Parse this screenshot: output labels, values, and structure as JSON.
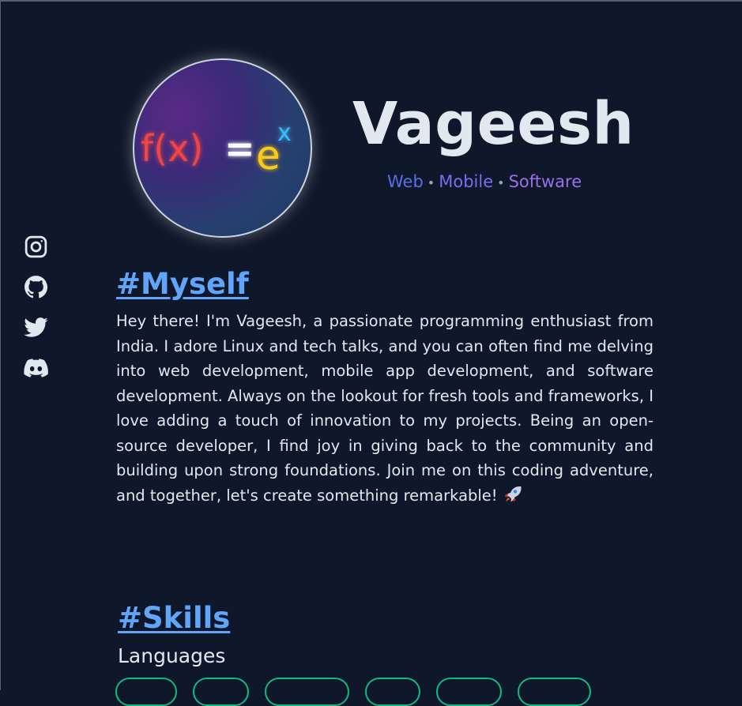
{
  "profile": {
    "name": "Vageesh",
    "tagline": [
      "Web",
      "Mobile",
      "Software"
    ],
    "avatar_formula": {
      "f": "f(x)",
      "eq": "=",
      "e": "e",
      "exp": "x"
    }
  },
  "socials": [
    {
      "icon": "instagram-icon"
    },
    {
      "icon": "github-icon"
    },
    {
      "icon": "twitter-icon"
    },
    {
      "icon": "discord-icon"
    }
  ],
  "myself": {
    "title": "#Myself",
    "text": "Hey there! I'm Vageesh, a passionate programming enthusiast from India. I adore Linux and tech talks, and you can often find me delving into web development, mobile app development, and software development. Always on the lookout for fresh tools and frameworks, I love adding a touch of innovation to my projects. Being an open-source developer, I find joy in giving back to the community and building upon strong foundations. Join me on this coding adventure, and together, let's create something remarkable!"
  },
  "skills": {
    "title": "#Skills",
    "subhead": "Languages"
  },
  "colors": {
    "background": "#0f172a",
    "accent": "#60a5fa",
    "pill_border": "#10b981"
  }
}
